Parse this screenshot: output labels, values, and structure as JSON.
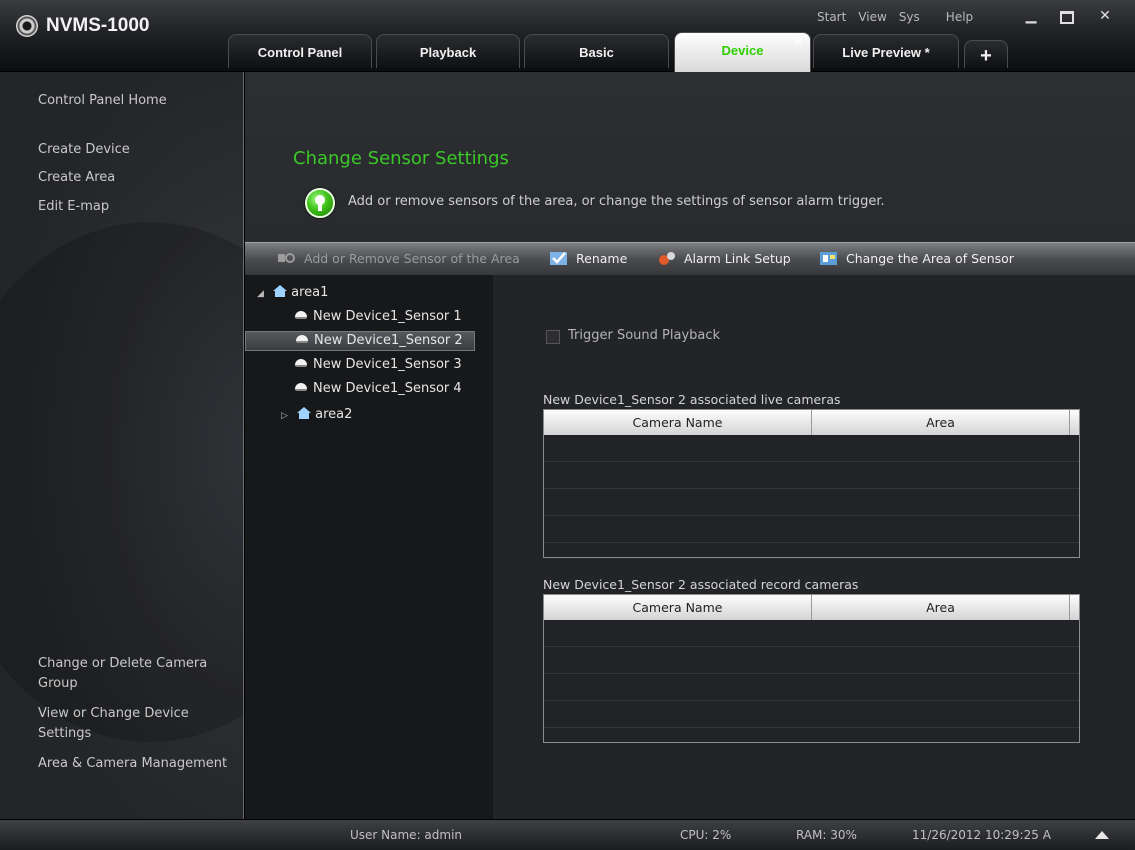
{
  "app": {
    "title": "NVMS-1000"
  },
  "top_menu": [
    "Start",
    "View",
    "Sys",
    "Help"
  ],
  "tabs": [
    {
      "label": "Control Panel"
    },
    {
      "label": "Playback"
    },
    {
      "label": "Basic"
    },
    {
      "label": "Device",
      "active": true
    },
    {
      "label": "Live Preview *"
    }
  ],
  "sidebar": {
    "home": "Control Panel Home",
    "items_top": [
      "Create Device",
      "Create Area",
      "Edit E-map"
    ],
    "items_bottom": [
      "Change or Delete Camera Group",
      "View or Change Device Settings",
      "Area & Camera Management"
    ]
  },
  "main": {
    "heading": "Change Sensor Settings",
    "info_text": "Add or remove sensors of the area, or change the settings of sensor alarm trigger."
  },
  "toolbar": {
    "add_remove": "Add or Remove Sensor of the Area",
    "rename": "Rename",
    "alarm_link": "Alarm Link Setup",
    "change_area": "Change the Area of Sensor"
  },
  "tree": {
    "area1": "area1",
    "sensors": [
      "New Device1_Sensor 1",
      "New Device1_Sensor 2",
      "New Device1_Sensor 3",
      "New Device1_Sensor 4"
    ],
    "selected_sensor_index": 1,
    "area2": "area2"
  },
  "settings": {
    "trigger_sound": "Trigger Sound Playback",
    "trigger_sound_checked": false,
    "live_label": "New Device1_Sensor 2 associated live cameras",
    "record_label": "New Device1_Sensor 2 associated record cameras",
    "columns": [
      "Camera Name",
      "Area"
    ]
  },
  "status": {
    "user": "User Name: admin",
    "cpu": "CPU: 2%",
    "ram": "RAM: 30%",
    "datetime": "11/26/2012 10:29:25 A"
  },
  "colors": {
    "accent_green": "#3ac828",
    "active_tab_text": "#2dd000"
  }
}
